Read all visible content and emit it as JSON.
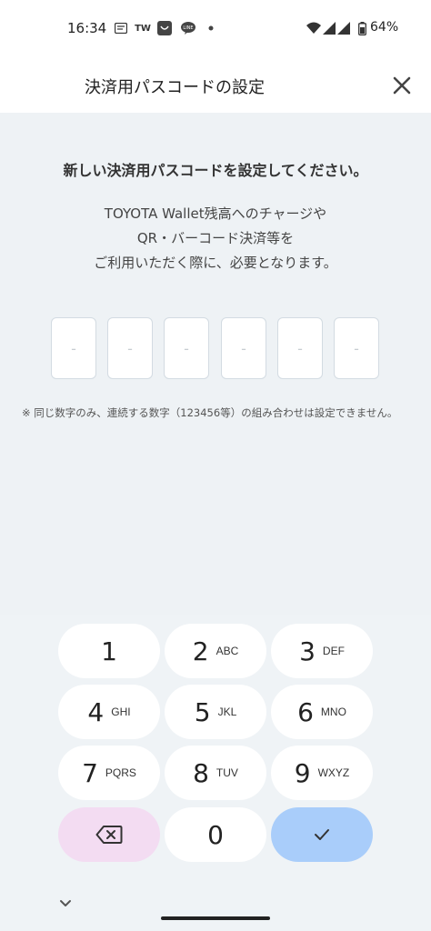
{
  "status_bar": {
    "time": "16:34",
    "tw_label": "TW",
    "battery": "64%"
  },
  "header": {
    "title": "決済用パスコードの設定"
  },
  "main": {
    "heading": "新しい決済用パスコードを設定してください。",
    "description_lines": [
      "TOYOTA Wallet残高へのチャージや",
      "QR・バーコード決済等を",
      "ご利用いただく際に、必要となります。"
    ],
    "pin_placeholders": [
      "-",
      "-",
      "-",
      "-",
      "-",
      "-"
    ],
    "note": "※ 同じ数字のみ、連続する数字（123456等）の組み合わせは設定できません。"
  },
  "keypad": {
    "keys": [
      {
        "num": "1",
        "letters": ""
      },
      {
        "num": "2",
        "letters": "ABC"
      },
      {
        "num": "3",
        "letters": "DEF"
      },
      {
        "num": "4",
        "letters": "GHI"
      },
      {
        "num": "5",
        "letters": "JKL"
      },
      {
        "num": "6",
        "letters": "MNO"
      },
      {
        "num": "7",
        "letters": "PQRS"
      },
      {
        "num": "8",
        "letters": "TUV"
      },
      {
        "num": "9",
        "letters": "WXYZ"
      },
      {
        "num": "0",
        "letters": ""
      }
    ]
  },
  "colors": {
    "content_bg": "#eef2f5",
    "delete_key": "#f3dcf2",
    "confirm_key": "#a9cdfa"
  }
}
